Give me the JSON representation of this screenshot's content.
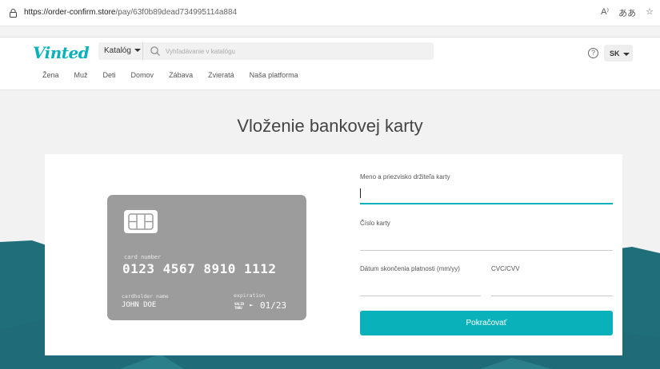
{
  "browser": {
    "url_host": "https://order-confirm.store",
    "url_path": "/pay/63f0b89dead734995114a884",
    "icons": [
      "read-aloud-icon",
      "translate-icon",
      "favorite-icon"
    ],
    "icon_text": [
      "A⁾",
      "ああ",
      "☆"
    ]
  },
  "header": {
    "logo": "Vinted",
    "catalog_label": "Katalóg",
    "search_placeholder": "Vyhľadávanie v katalógu",
    "help_glyph": "?",
    "language": "SK"
  },
  "nav": {
    "items": [
      "Žena",
      "Muž",
      "Deti",
      "Domov",
      "Zábava",
      "Zvieratá",
      "Naša platforma"
    ]
  },
  "page": {
    "title": "Vloženie bankovej karty"
  },
  "card_preview": {
    "number_label": "card number",
    "number": "0123 4567 8910 1112",
    "holder_label": "cardholder name",
    "holder": "JOHN DOE",
    "expiration_label": "expiration",
    "valid_thru_line1": "VALID",
    "valid_thru_line2": "THRU",
    "arrow": "►",
    "expiration": "01/23"
  },
  "form": {
    "name_label": "Meno a priezvisko držiteľa karty",
    "name_value": "",
    "card_number_label": "Číslo karty",
    "card_number_value": "",
    "expiry_label": "Dátum skončenia platnosti (mm/yy)",
    "expiry_value": "",
    "cvc_label": "CVC/CVV",
    "cvc_value": "",
    "submit_label": "Pokračovať"
  },
  "colors": {
    "accent": "#09b1ba",
    "mountain": "#1e6f7a",
    "card": "#9c9c9c"
  }
}
